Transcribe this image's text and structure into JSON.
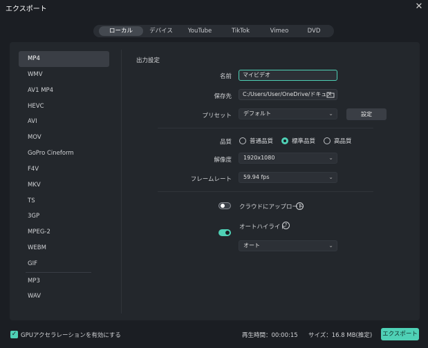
{
  "window": {
    "title": "エクスポート",
    "close_icon": "close-icon"
  },
  "tabs": [
    {
      "label": "ローカル",
      "active": true
    },
    {
      "label": "デバイス"
    },
    {
      "label": "YouTube"
    },
    {
      "label": "TikTok"
    },
    {
      "label": "Vimeo"
    },
    {
      "label": "DVD"
    }
  ],
  "formats": [
    "MP4",
    "WMV",
    "AV1 MP4",
    "HEVC",
    "AVI",
    "MOV",
    "GoPro Cineform",
    "F4V",
    "MKV",
    "TS",
    "3GP",
    "MPEG-2",
    "WEBM",
    "GIF",
    "MP3",
    "WAV"
  ],
  "selected_format": "MP4",
  "settings": {
    "section_title": "出力設定",
    "name_label": "名前",
    "name_value": "マイビデオ",
    "save_label": "保存先",
    "save_value": "C:/Users/User/OneDrive/ドキュメ",
    "preset_label": "プリセット",
    "preset_value": "デフォルト",
    "preset_button": "設定",
    "quality_label": "品質",
    "quality_options": [
      "普通品質",
      "標準品質",
      "高品質"
    ],
    "quality_selected": "標準品質",
    "resolution_label": "解像度",
    "resolution_value": "1920x1080",
    "framerate_label": "フレームレート",
    "framerate_value": "59.94 fps",
    "cloud_upload_label": "クラウドにアップロード",
    "cloud_upload_on": false,
    "auto_highlight_label": "オートハイライト",
    "auto_highlight_on": true,
    "auto_value": "オート"
  },
  "footer": {
    "gpu_label": "GPUアクセラレーションを有効にする",
    "gpu_checked": true,
    "playtime": "再生時間：00:00:15",
    "size": "サイズ：16.8 MB(推定)",
    "export_button": "エクスポート"
  },
  "colors": {
    "accent": "#4fd1b6",
    "background": "#1b1e23",
    "panel": "#23272c"
  }
}
